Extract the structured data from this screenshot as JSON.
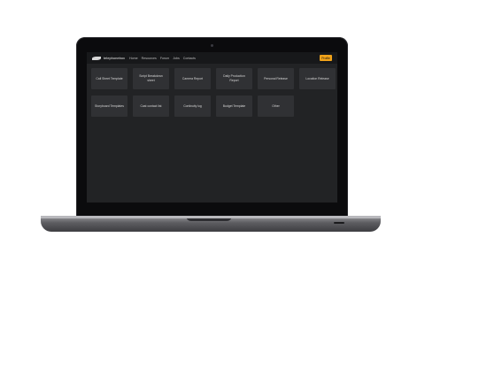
{
  "navbar": {
    "brand": "telephonebox",
    "links": [
      "Home",
      "Resources",
      "Forum",
      "Jobs",
      "Contacts"
    ],
    "cta_label": "Profile"
  },
  "templates": [
    "Call Sheet Template",
    "Script Breakdown sheet",
    "Camera Report",
    "Daily Production Report",
    "Personal Release",
    "Location Release",
    "Storyboard Templates",
    "Cast contact list",
    "Continuity log",
    "Budget Template",
    "Other"
  ]
}
